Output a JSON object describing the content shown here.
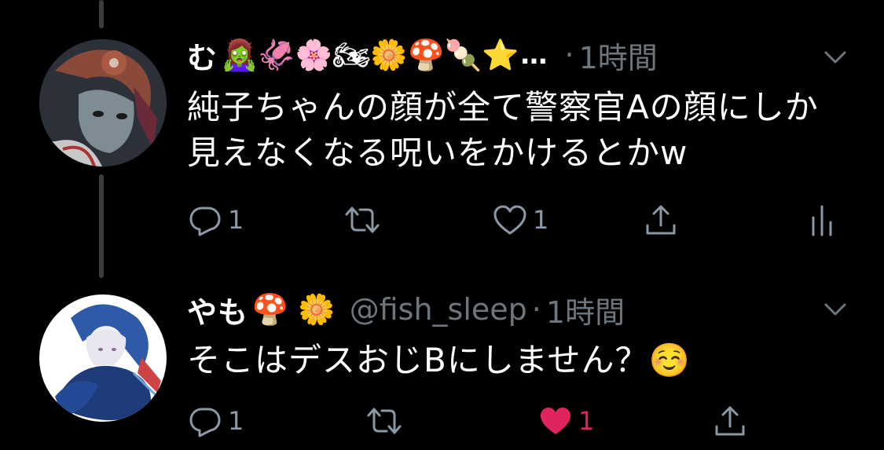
{
  "colors": {
    "background": "#000000",
    "text_primary": "#ffffff",
    "text_secondary": "#6e767d",
    "icon_gray": "#8b98a5",
    "like_pink": "#e0245e",
    "thread_line": "#3d3d3d"
  },
  "tweets": [
    {
      "display_name": "む",
      "name_emojis": "🧟‍♀️🦑🌸🏍🌼🍄🍡⭐",
      "truncation": "…",
      "handle": "",
      "separator": "·",
      "time": "1時間",
      "text_line1": "純子ちゃんの顔が全て警察官Aの顔にしか",
      "text_line2": "見えなくなる呪いをかけるとかw",
      "reply_count": "1",
      "retweet_count": "",
      "like_count": "1",
      "liked": false,
      "icons": [
        "reply-icon",
        "retweet-icon",
        "heart-outline-icon",
        "share-icon",
        "analytics-icon"
      ]
    },
    {
      "display_name": "やも",
      "name_emojis": "🍄 🌼",
      "truncation": "",
      "handle": "@fish_sleep",
      "separator": "·",
      "time": "1時間",
      "text_line1": "そこはデスおじBにしません？☺️",
      "text_line2": "",
      "reply_count": "1",
      "retweet_count": "",
      "like_count": "1",
      "liked": true,
      "icons": [
        "reply-icon",
        "retweet-icon",
        "heart-filled-icon",
        "share-icon"
      ]
    }
  ]
}
